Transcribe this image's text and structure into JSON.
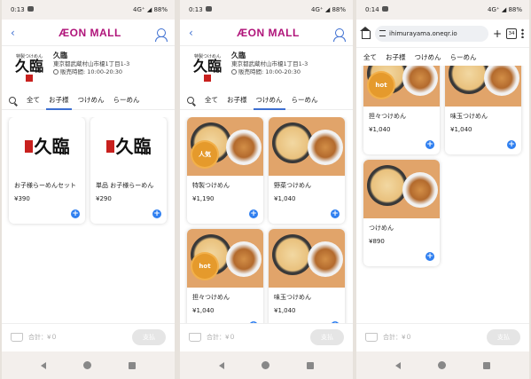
{
  "panels": [
    {
      "status": {
        "time": "0:13",
        "right": "4G⁺ ◢ 88%"
      },
      "header": {
        "logo": "ÆON MALL"
      },
      "shop": {
        "logo_top": "特製つけめん",
        "logo_main": "久臨",
        "name": "久臨",
        "address": "東京都武蔵村山市榎1丁目1-3",
        "hours": "販売時間: 10:00-20:30"
      },
      "tabs": [
        "全て",
        "お子様",
        "つけめん",
        "らーめん"
      ],
      "active_tab": 1,
      "cards": [
        {
          "name": "お子様らーめんセット",
          "price": "¥390",
          "image": "brand-logo"
        },
        {
          "name": "単品 お子様らーめん",
          "price": "¥290",
          "image": "brand-logo"
        }
      ],
      "cart": {
        "total": "合計：¥０",
        "pay": "支払"
      }
    },
    {
      "status": {
        "time": "0:13",
        "right": "4G⁺ ◢ 88%"
      },
      "header": {
        "logo": "ÆON MALL"
      },
      "shop": {
        "logo_top": "特製つけめん",
        "logo_main": "久臨",
        "name": "久臨",
        "address": "東京都武蔵村山市榎1丁目1-3",
        "hours": "販売時間: 10:00-20:30"
      },
      "tabs": [
        "全て",
        "お子様",
        "つけめん",
        "らーめん"
      ],
      "active_tab": 2,
      "cards": [
        {
          "name": "特製つけめん",
          "price": "¥1,190",
          "badge": "人気"
        },
        {
          "name": "野菜つけめん",
          "price": "¥1,040"
        },
        {
          "name": "担々つけめん",
          "price": "¥1,040",
          "badge": "hot"
        },
        {
          "name": "味玉つけめん",
          "price": "¥1,040"
        }
      ],
      "cart": {
        "total": "合計：¥０",
        "pay": "支払"
      }
    },
    {
      "status": {
        "time": "0:14",
        "right": "4G⁺ ◢ 88%"
      },
      "browser": {
        "url": "ihimurayama.oneqr.io",
        "tab_count": "34"
      },
      "tabs": [
        "全て",
        "お子様",
        "つけめん",
        "らーめん"
      ],
      "active_tab": 2,
      "cards": [
        {
          "name": "担々つけめん",
          "price": "¥1,040",
          "badge": "hot"
        },
        {
          "name": "味玉つけめん",
          "price": "¥1,040"
        },
        {
          "name": "つけめん",
          "price": "¥890"
        }
      ],
      "cart": {
        "total": "合計：¥０",
        "pay": "支払"
      }
    }
  ],
  "colors": {
    "accent": "#3d6fd1",
    "brand": "#b0147a",
    "badge": "#e59a2c",
    "plus": "#2f7ff0"
  }
}
